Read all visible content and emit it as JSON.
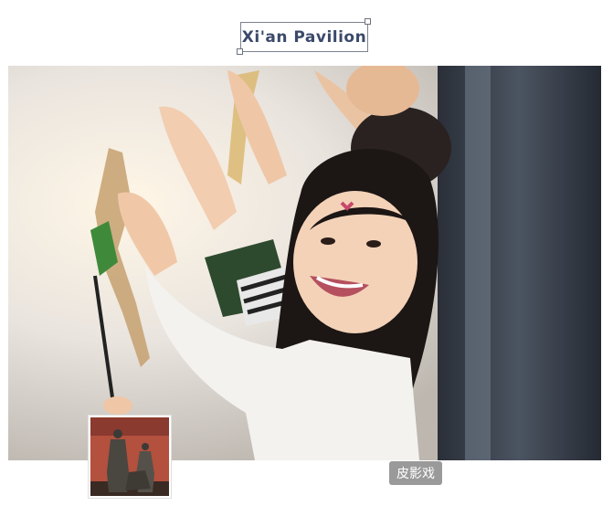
{
  "header": {
    "title": "Xi'an Pavilion"
  },
  "hero_image": {
    "icon": "photo-child-shadow-puppet",
    "alt": ""
  },
  "thumbnail": {
    "icon": "photo-terracotta-figures"
  },
  "caption": {
    "label": "皮影戏"
  },
  "colors": {
    "title_text": "#3b4a6a",
    "title_border": "#7a8290",
    "badge_bg": "#9a9a9a",
    "badge_text": "#ffffff"
  }
}
